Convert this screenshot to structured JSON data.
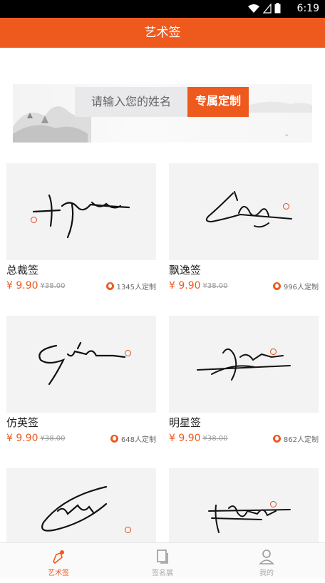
{
  "statusbar": {
    "time": "6:19"
  },
  "header": {
    "title": "艺术签"
  },
  "search": {
    "placeholder": "请输入您的姓名",
    "button_label": "专属定制"
  },
  "products": [
    {
      "name": "总裁签",
      "price": "¥ 9.90",
      "old_price": "¥38.00",
      "count": "1345人定制"
    },
    {
      "name": "飘逸签",
      "price": "¥ 9.90",
      "old_price": "¥38.00",
      "count": "996人定制"
    },
    {
      "name": "仿英签",
      "price": "¥ 9.90",
      "old_price": "¥38.00",
      "count": "648人定制"
    },
    {
      "name": "明星签",
      "price": "¥ 9.90",
      "old_price": "¥38.00",
      "count": "862人定制"
    },
    {
      "name": "",
      "price": "",
      "old_price": "",
      "count": ""
    },
    {
      "name": "",
      "price": "",
      "old_price": "",
      "count": ""
    }
  ],
  "tabs": [
    {
      "label": "艺术签",
      "icon": "pen-icon",
      "active": true
    },
    {
      "label": "签名展",
      "icon": "gallery-icon",
      "active": false
    },
    {
      "label": "我的",
      "icon": "user-icon",
      "active": false
    }
  ],
  "colors": {
    "accent": "#ee5a1e"
  }
}
